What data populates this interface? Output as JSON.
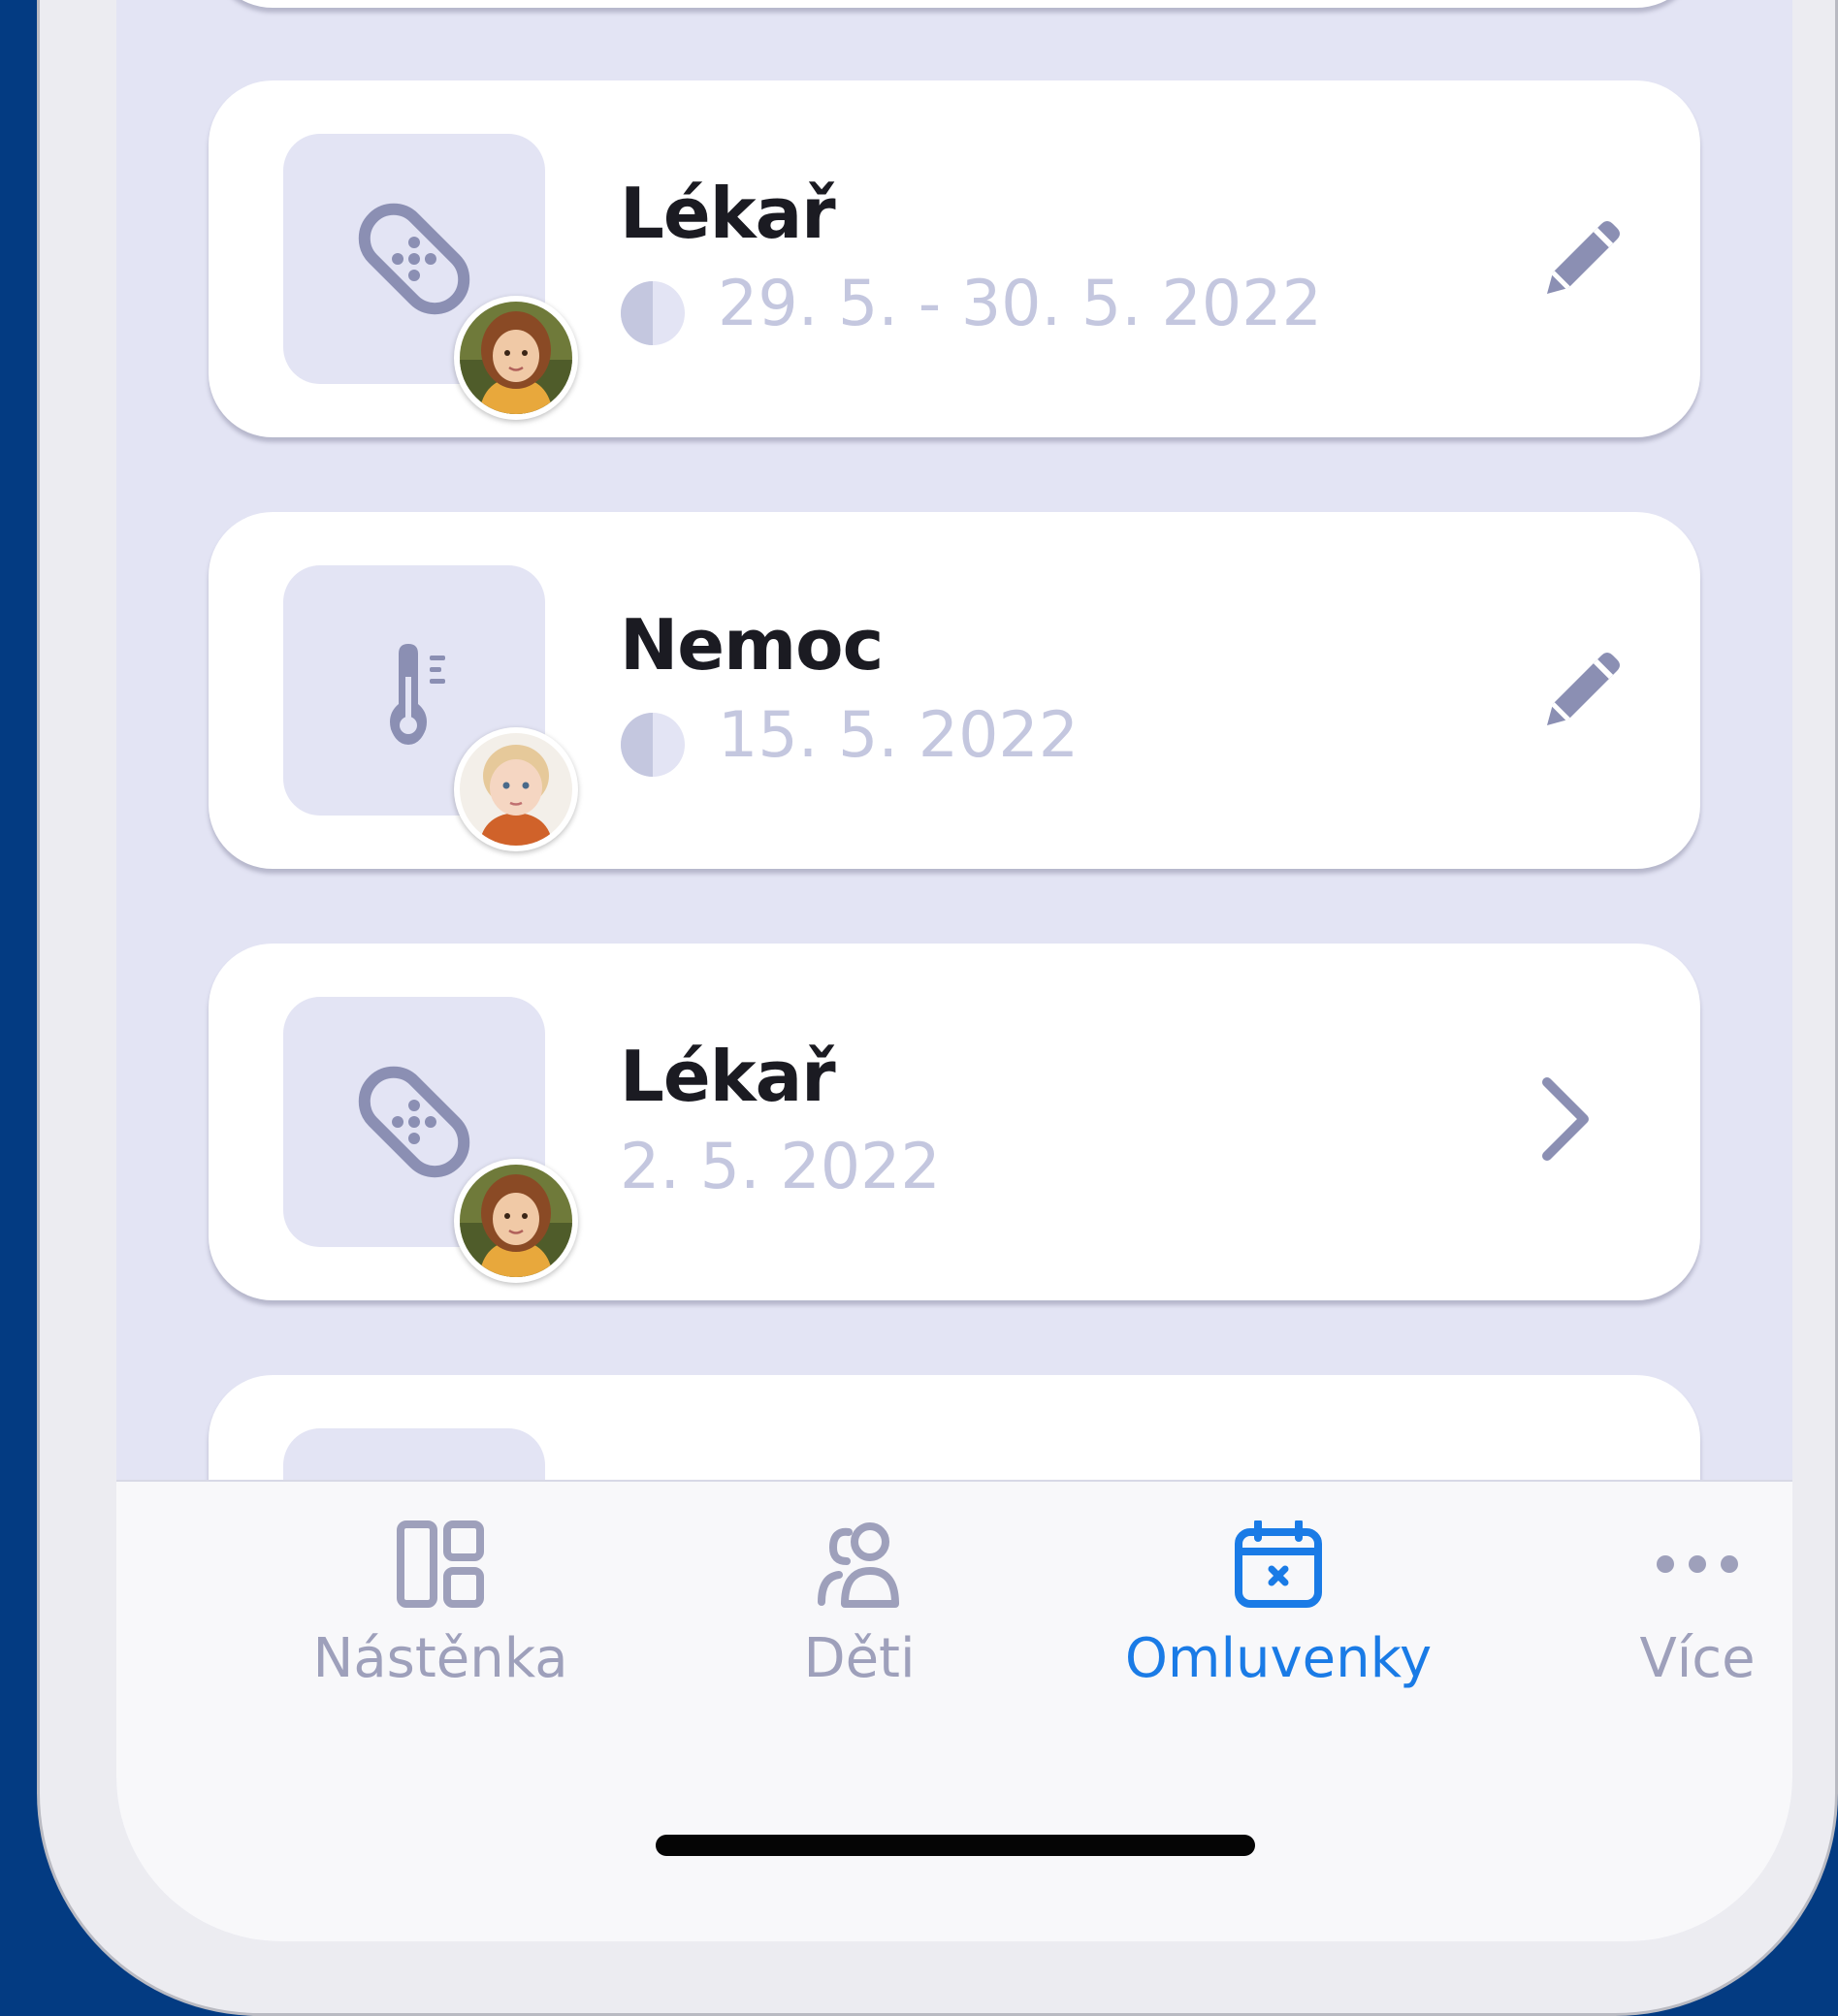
{
  "colors": {
    "background": "#033b82",
    "screen": "#e3e4f4",
    "card": "#ffffff",
    "icon": "#8b8fb3",
    "muted_text": "#c4c7df",
    "active": "#1a7be6"
  },
  "excuses": [
    {
      "title": "Lékař",
      "date": "29. 5. - 30. 5. 2022",
      "icon": "bandage-icon",
      "half_day": true,
      "action": "edit-icon",
      "avatar": "child-girl-brown-hair"
    },
    {
      "title": "Nemoc",
      "date": "15. 5. 2022",
      "icon": "thermometer-icon",
      "half_day": true,
      "action": "edit-icon",
      "avatar": "child-blonde"
    },
    {
      "title": "Lékař",
      "date": "2. 5. 2022",
      "icon": "bandage-icon",
      "half_day": false,
      "action": "chevron-right-icon",
      "avatar": "child-girl-brown-hair"
    }
  ],
  "nav": {
    "items": [
      {
        "label": "Nástěnka",
        "icon": "dashboard-icon",
        "active": false
      },
      {
        "label": "Děti",
        "icon": "children-icon",
        "active": false
      },
      {
        "label": "Omluvenky",
        "icon": "calendar-x-icon",
        "active": true
      },
      {
        "label": "Více",
        "icon": "more-icon",
        "active": false
      }
    ]
  }
}
